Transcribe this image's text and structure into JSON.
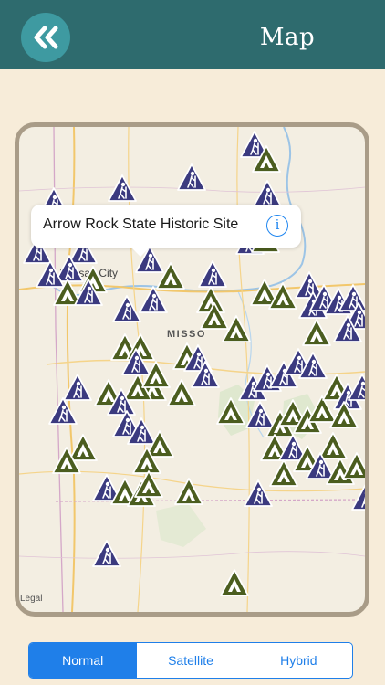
{
  "header": {
    "title": "Map",
    "back_icon": "double-chevron-left-icon"
  },
  "map": {
    "labels": {
      "city": "Kansas City",
      "state": "MISSO",
      "legal": "Legal"
    },
    "callout": {
      "title": "Arrow Rock State Historic Site",
      "info_icon": "info-icon"
    },
    "marker_types": {
      "hiking": "hiker-icon",
      "camping": "tent-icon"
    }
  },
  "map_type": {
    "options": [
      "Normal",
      "Satellite",
      "Hybrid"
    ],
    "selected": "Normal"
  },
  "colors": {
    "header": "#2e6b6e",
    "back_button": "#3e9aa1",
    "background": "#f7ecd9",
    "hike_marker": "#3b3a7f",
    "tent_marker": "#4b5d1f",
    "accent": "#1f7fe9"
  }
}
